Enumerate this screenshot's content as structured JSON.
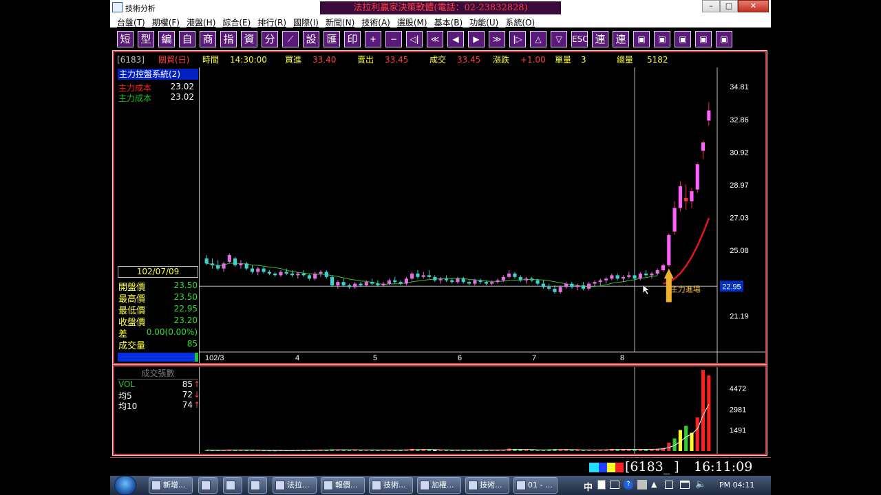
{
  "window": {
    "app_title": "技術分析",
    "banner": "法拉利贏家決策軟體(電話：02-23832828)",
    "minimize": "–",
    "maximize": "□",
    "close": "✕"
  },
  "menu": [
    "台盤(T)",
    "期權(F)",
    "港盤(H)",
    "綜合(E)",
    "排行(R)",
    "國際(I)",
    "新聞(N)",
    "技術(A)",
    "選股(M)",
    "基本(B)",
    "功能(U)",
    "系統(O)"
  ],
  "toolbar": {
    "text_buttons": [
      "短",
      "型",
      "編",
      "自",
      "商",
      "指",
      "資",
      "分"
    ],
    "text_buttons2": [
      "設",
      "匯",
      "印"
    ],
    "text_buttons3": [
      "連",
      "連"
    ],
    "icon_buttons": [
      "+",
      "−",
      "◁|",
      "≪",
      "◀",
      "▶",
      "≫",
      "|▷",
      "△",
      "▽",
      "ESC"
    ]
  },
  "quote": {
    "code": "[6183]",
    "name": "關貿(日)",
    "time_label": "時間",
    "time": "14:30:00",
    "bid_label": "買進",
    "bid": "33.40",
    "ask_label": "賣出",
    "ask": "33.45",
    "deal_label": "成交",
    "deal": "33.45",
    "change_label": "漲跌",
    "change": "+1.00",
    "single_label": "單量",
    "single": "3",
    "total_label": "總量",
    "total": "5182"
  },
  "indicator": {
    "title": "主力控盤系統(2)",
    "rows": [
      {
        "label": "主力成本",
        "value": "23.02",
        "color": "#ff2020"
      },
      {
        "label": "主力成本",
        "value": "23.02",
        "color": "#20c020"
      }
    ]
  },
  "ohlc": {
    "date": "102/07/09",
    "rows": [
      {
        "label": "開盤價",
        "value": "23.50"
      },
      {
        "label": "最高價",
        "value": "23.50"
      },
      {
        "label": "最低價",
        "value": "22.95"
      },
      {
        "label": "收盤價",
        "value": "23.20"
      },
      {
        "label": "差",
        "value": "0.00(0.00%)"
      },
      {
        "label": "成交量",
        "value": "85"
      }
    ]
  },
  "price_axis": [
    "34.81",
    "32.86",
    "30.92",
    "28.97",
    "27.03",
    "25.08",
    "21.19"
  ],
  "cursor_price": "22.95",
  "x_axis": [
    "102/3",
    "4",
    "5",
    "6",
    "7",
    "8"
  ],
  "annotation": "主力進場",
  "volume_panel": {
    "title": "成交張數",
    "rows": [
      {
        "label": "VOL",
        "value": "85",
        "arrow": "↑",
        "color": "#30c030"
      },
      {
        "label": "均5",
        "value": "72",
        "arrow": "↓",
        "color": "#ffffff"
      },
      {
        "label": "均10",
        "value": "74",
        "arrow": "↑",
        "color": "#ffffff"
      }
    ],
    "axis": [
      "4472",
      "2981",
      "1491"
    ]
  },
  "status": {
    "code": "[6183_ ]",
    "clock": "16:11:09"
  },
  "taskbar": {
    "tasks": [
      "新增...",
      "",
      "",
      "",
      "法拉...",
      "報價...",
      "技術...",
      "加權...",
      "技術...",
      "01 - ..."
    ],
    "ime": "中",
    "clock": "PM 04:11"
  },
  "chart_data": {
    "type": "candlestick",
    "ylim": [
      19.2,
      35.8
    ],
    "y_ticks": [
      34.81,
      32.86,
      30.92,
      28.97,
      27.03,
      25.08,
      21.19
    ],
    "x_labels": [
      "102/3",
      "4",
      "5",
      "6",
      "7",
      "8"
    ],
    "candles": [
      [
        24.6,
        24.8,
        24.2,
        24.3
      ],
      [
        24.3,
        24.6,
        24.0,
        24.2
      ],
      [
        24.2,
        24.5,
        23.9,
        24.0
      ],
      [
        24.0,
        24.4,
        23.8,
        24.3
      ],
      [
        24.4,
        24.9,
        24.3,
        24.8
      ],
      [
        24.6,
        24.7,
        24.1,
        24.2
      ],
      [
        24.2,
        24.5,
        24.0,
        24.3
      ],
      [
        24.3,
        24.4,
        23.9,
        24.0
      ],
      [
        24.0,
        24.2,
        23.7,
        23.8
      ],
      [
        23.8,
        24.1,
        23.6,
        24.0
      ],
      [
        24.0,
        24.1,
        23.7,
        23.8
      ],
      [
        23.8,
        23.9,
        23.6,
        23.7
      ],
      [
        23.7,
        23.8,
        23.5,
        23.6
      ],
      [
        23.6,
        23.9,
        23.5,
        23.8
      ],
      [
        23.8,
        24.0,
        23.6,
        23.7
      ],
      [
        23.7,
        23.9,
        23.5,
        23.6
      ],
      [
        23.6,
        23.8,
        23.4,
        23.7
      ],
      [
        23.7,
        23.9,
        23.5,
        23.6
      ],
      [
        23.6,
        23.7,
        23.3,
        23.4
      ],
      [
        23.4,
        23.8,
        23.3,
        23.7
      ],
      [
        23.7,
        23.9,
        23.5,
        23.8
      ],
      [
        23.8,
        23.9,
        23.4,
        23.5
      ],
      [
        23.5,
        23.6,
        22.9,
        23.0
      ],
      [
        23.0,
        23.3,
        22.8,
        23.2
      ],
      [
        23.2,
        23.4,
        22.9,
        23.0
      ],
      [
        23.0,
        23.1,
        22.8,
        22.9
      ],
      [
        22.9,
        23.2,
        22.8,
        23.1
      ],
      [
        23.1,
        23.2,
        22.9,
        23.0
      ],
      [
        23.0,
        23.3,
        22.9,
        23.2
      ],
      [
        23.2,
        23.4,
        23.0,
        23.1
      ],
      [
        23.1,
        23.3,
        22.9,
        23.0
      ],
      [
        23.0,
        23.2,
        22.9,
        23.1
      ],
      [
        23.1,
        23.4,
        23.0,
        23.3
      ],
      [
        23.3,
        23.5,
        23.1,
        23.2
      ],
      [
        23.2,
        23.3,
        23.0,
        23.1
      ],
      [
        23.1,
        23.5,
        23.0,
        23.4
      ],
      [
        23.4,
        23.8,
        23.3,
        23.7
      ],
      [
        23.7,
        23.9,
        23.4,
        23.5
      ],
      [
        23.5,
        23.8,
        23.4,
        23.6
      ],
      [
        23.6,
        23.9,
        23.4,
        23.5
      ],
      [
        23.5,
        23.6,
        23.2,
        23.3
      ],
      [
        23.3,
        23.5,
        23.1,
        23.4
      ],
      [
        23.4,
        23.6,
        23.2,
        23.3
      ],
      [
        23.3,
        23.4,
        23.1,
        23.2
      ],
      [
        23.2,
        23.5,
        23.1,
        23.4
      ],
      [
        23.4,
        23.5,
        23.1,
        23.2
      ],
      [
        23.2,
        23.3,
        23.0,
        23.1
      ],
      [
        23.1,
        23.4,
        23.0,
        23.3
      ],
      [
        23.3,
        23.4,
        23.1,
        23.2
      ],
      [
        23.2,
        23.3,
        23.0,
        23.1
      ],
      [
        23.1,
        23.3,
        23.0,
        23.2
      ],
      [
        23.2,
        23.4,
        23.1,
        23.3
      ],
      [
        23.3,
        23.6,
        23.2,
        23.5
      ],
      [
        23.5,
        23.9,
        23.4,
        23.7
      ],
      [
        23.7,
        23.8,
        23.4,
        23.5
      ],
      [
        23.5,
        23.6,
        23.2,
        23.3
      ],
      [
        23.3,
        23.5,
        23.1,
        23.4
      ],
      [
        23.4,
        23.5,
        23.2,
        23.3
      ],
      [
        23.3,
        23.4,
        23.0,
        23.1
      ],
      [
        23.1,
        23.3,
        22.8,
        22.9
      ],
      [
        22.9,
        23.1,
        22.7,
        22.8
      ],
      [
        22.8,
        23.0,
        22.5,
        22.6
      ],
      [
        22.6,
        23.0,
        22.5,
        22.9
      ],
      [
        22.9,
        23.2,
        22.8,
        23.1
      ],
      [
        23.1,
        23.2,
        22.8,
        22.9
      ],
      [
        22.9,
        23.1,
        22.7,
        23.0
      ],
      [
        23.0,
        23.2,
        22.7,
        22.8
      ],
      [
        22.8,
        23.2,
        22.7,
        23.1
      ],
      [
        23.1,
        23.3,
        22.9,
        23.2
      ],
      [
        23.2,
        23.4,
        23.0,
        23.3
      ],
      [
        23.3,
        23.5,
        23.1,
        23.4
      ],
      [
        23.4,
        23.7,
        23.3,
        23.6
      ],
      [
        23.6,
        23.7,
        23.3,
        23.4
      ],
      [
        23.4,
        23.6,
        23.2,
        23.5
      ],
      [
        23.5,
        23.8,
        23.4,
        23.6
      ],
      [
        23.6,
        23.7,
        23.3,
        23.4
      ],
      [
        23.4,
        23.8,
        23.3,
        23.7
      ],
      [
        23.7,
        23.9,
        23.5,
        23.6
      ],
      [
        23.6,
        23.8,
        23.4,
        23.7
      ],
      [
        23.7,
        24.0,
        23.6,
        23.9
      ],
      [
        23.9,
        24.3,
        23.8,
        24.2
      ],
      [
        24.2,
        26.1,
        24.1,
        26.0
      ],
      [
        26.2,
        28.0,
        26.0,
        27.6
      ],
      [
        27.6,
        29.2,
        27.4,
        28.9
      ],
      [
        28.2,
        29.0,
        27.5,
        28.0
      ],
      [
        28.0,
        28.8,
        27.6,
        28.6
      ],
      [
        28.7,
        30.3,
        28.5,
        30.2
      ],
      [
        31.0,
        31.6,
        30.5,
        31.5
      ],
      [
        32.8,
        33.9,
        32.5,
        33.4
      ]
    ],
    "cost_line_start": 80,
    "volume": {
      "ylim": [
        0,
        5900
      ],
      "values": [
        60,
        40,
        50,
        45,
        90,
        70,
        55,
        50,
        45,
        60,
        40,
        35,
        30,
        50,
        45,
        40,
        60,
        50,
        45,
        70,
        80,
        60,
        120,
        90,
        70,
        60,
        80,
        70,
        90,
        60,
        55,
        60,
        80,
        70,
        60,
        110,
        160,
        90,
        120,
        80,
        60,
        70,
        60,
        50,
        80,
        60,
        50,
        70,
        60,
        50,
        60,
        70,
        100,
        180,
        150,
        90,
        70,
        60,
        50,
        90,
        120,
        140,
        110,
        80,
        60,
        70,
        60,
        90,
        80,
        100,
        110,
        150,
        120,
        100,
        130,
        110,
        140,
        130,
        120,
        160,
        220,
        600,
        900,
        1500,
        1800,
        1300,
        2400,
        5800,
        5400
      ],
      "ma_start": 82
    }
  }
}
